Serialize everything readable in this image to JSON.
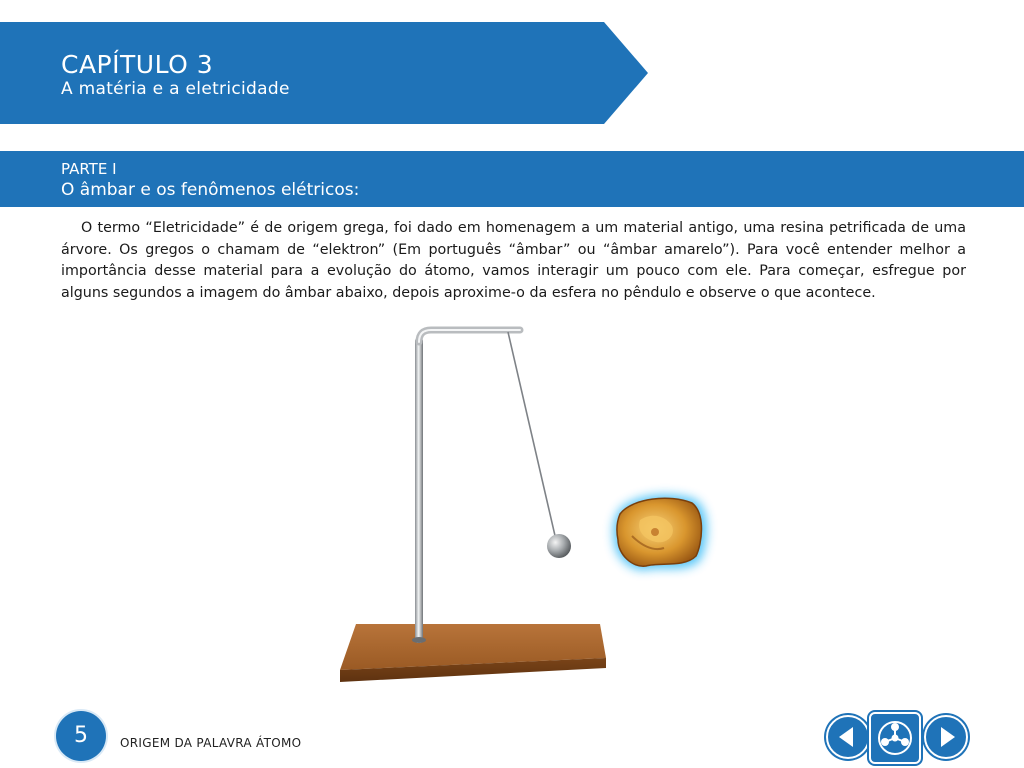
{
  "chapter": {
    "title": "CAPÍTULO 3",
    "subtitle": "A matéria e a eletricidade"
  },
  "part": {
    "label": "PARTE I",
    "title": "O âmbar e os fenômenos elétricos:"
  },
  "body_text": "O termo “Eletricidade” é de origem grega, foi dado em homenagem a um material antigo, uma resina petrificada de uma árvore. Os gregos o chamam de “elektron” (Em português “âmbar” ou “âmbar amarelo”). Para você entender melhor a importância desse material para a evolução do átomo, vamos interagir um pouco com ele. Para começar, esfregue por alguns segundos a imagem do âmbar abaixo, depois aproxime-o da esfera no pêndulo e observe o que acontece.",
  "footer": {
    "page_number": "5",
    "section_title": "ORIGEM DA PALAVRA ÁTOMO"
  },
  "navigation": {
    "prev_icon": "arrow-left-icon",
    "menu_icon": "molecule-menu-icon",
    "next_icon": "arrow-right-icon"
  },
  "colors": {
    "brand_blue": "#1f73b8",
    "wood": "#a8652b",
    "amber": "#e0a23a",
    "glow": "#4fc3f7"
  }
}
